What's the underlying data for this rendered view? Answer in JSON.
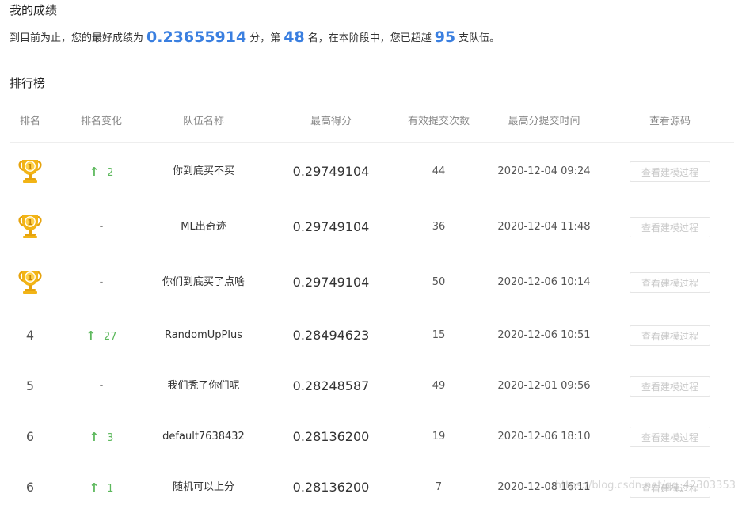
{
  "sections": {
    "my_score_title": "我的成绩",
    "leaderboard_title": "排行榜"
  },
  "summary": {
    "prefix": "到目前为止，您的最好成绩为",
    "best_score": "0.23655914",
    "mid1": "分，第",
    "rank": "48",
    "mid2": "名，在本阶段中，您已超越",
    "surpassed": "95",
    "suffix": "支队伍。"
  },
  "table": {
    "headers": {
      "rank": "排名",
      "change": "排名变化",
      "team": "队伍名称",
      "score": "最高得分",
      "count": "有效提交次数",
      "time": "最高分提交时间",
      "source": "查看源码"
    },
    "rows": [
      {
        "rank": "1",
        "trophy": true,
        "change_dir": "up",
        "change": "2",
        "team": "你到底买不买",
        "score": "0.29749104",
        "count": "44",
        "time": "2020-12-04 09:24",
        "button": "查看建模过程"
      },
      {
        "rank": "1",
        "trophy": true,
        "change_dir": "none",
        "change": "-",
        "team": "ML出奇迹",
        "score": "0.29749104",
        "count": "36",
        "time": "2020-12-04 11:48",
        "button": "查看建模过程"
      },
      {
        "rank": "1",
        "trophy": true,
        "change_dir": "none",
        "change": "-",
        "team": "你们到底买了点啥",
        "score": "0.29749104",
        "count": "50",
        "time": "2020-12-06 10:14",
        "button": "查看建模过程"
      },
      {
        "rank": "4",
        "trophy": false,
        "change_dir": "up",
        "change": "27",
        "team": "RandomUpPlus",
        "score": "0.28494623",
        "count": "15",
        "time": "2020-12-06 10:51",
        "button": "查看建模过程"
      },
      {
        "rank": "5",
        "trophy": false,
        "change_dir": "none",
        "change": "-",
        "team": "我们秃了你们呢",
        "score": "0.28248587",
        "count": "49",
        "time": "2020-12-01 09:56",
        "button": "查看建模过程"
      },
      {
        "rank": "6",
        "trophy": false,
        "change_dir": "up",
        "change": "3",
        "team": "default7638432",
        "score": "0.28136200",
        "count": "19",
        "time": "2020-12-06 18:10",
        "button": "查看建模过程"
      },
      {
        "rank": "6",
        "trophy": false,
        "change_dir": "up",
        "change": "1",
        "team": "随机可以上分",
        "score": "0.28136200",
        "count": "7",
        "time": "2020-12-08 16:11",
        "button": "查看建模过程"
      }
    ]
  },
  "icons": {
    "trophy": "trophy-icon",
    "up_arrow": "arrow-up-icon"
  },
  "colors": {
    "accent_blue": "#3a7fe0",
    "up_green": "#5cb85c",
    "trophy_gold": "#f2b416"
  },
  "watermark": "https://blog.csdn.net/qq_42303353"
}
